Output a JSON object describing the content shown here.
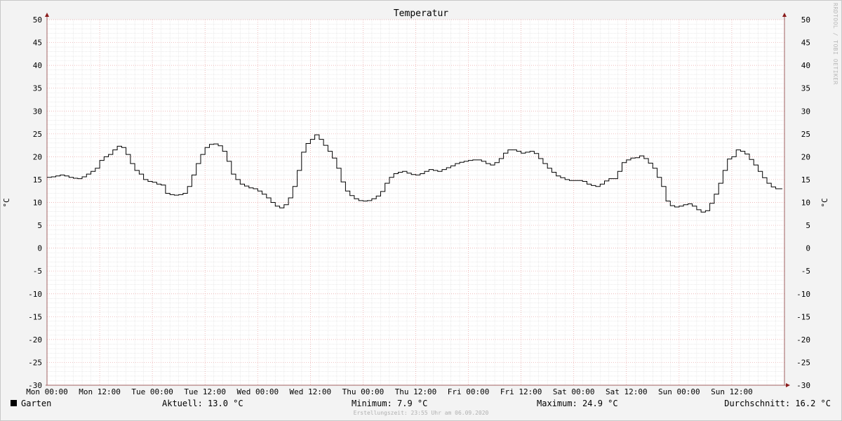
{
  "chart_data": {
    "type": "line",
    "title": "Temperatur",
    "ylabel": "°C",
    "ylim": [
      -30,
      50
    ],
    "yticks": [
      50,
      45,
      40,
      35,
      30,
      25,
      20,
      15,
      10,
      5,
      0,
      -5,
      -10,
      -15,
      -20,
      -25,
      -30
    ],
    "ytick_labels": [
      "50",
      "45",
      "40",
      "35",
      "30",
      "25",
      "20",
      "15",
      "10",
      "5",
      "0",
      "-5",
      "-10",
      "-15",
      "-20",
      "-25",
      "-30"
    ],
    "xlim_hours": [
      0,
      168
    ],
    "xtick_labels": [
      "Mon 00:00",
      "Mon 12:00",
      "Tue 00:00",
      "Tue 12:00",
      "Wed 00:00",
      "Wed 12:00",
      "Thu 00:00",
      "Thu 12:00",
      "Fri 00:00",
      "Fri 12:00",
      "Sat 00:00",
      "Sat 12:00",
      "Sun 00:00",
      "Sun 12:00"
    ],
    "grid": true,
    "line_color": "#000000",
    "grid_color": "#e8a0a0",
    "series": [
      {
        "name": "Garten",
        "color": "#000000",
        "x": [
          0,
          1,
          2,
          3,
          4,
          5,
          6,
          7,
          8,
          9,
          10,
          11,
          12,
          13,
          14,
          15,
          16,
          17,
          18,
          19,
          20,
          21,
          22,
          23,
          24,
          25,
          26,
          27,
          28,
          29,
          30,
          31,
          32,
          33,
          34,
          35,
          36,
          37,
          38,
          39,
          40,
          41,
          42,
          43,
          44,
          45,
          46,
          47,
          48,
          49,
          50,
          51,
          52,
          53,
          54,
          55,
          56,
          57,
          58,
          59,
          60,
          61,
          62,
          63,
          64,
          65,
          66,
          67,
          68,
          69,
          70,
          71,
          72,
          73,
          74,
          75,
          76,
          77,
          78,
          79,
          80,
          81,
          82,
          83,
          84,
          85,
          86,
          87,
          88,
          89,
          90,
          91,
          92,
          93,
          94,
          95,
          96,
          97,
          98,
          99,
          100,
          101,
          102,
          103,
          104,
          105,
          106,
          107,
          108,
          109,
          110,
          111,
          112,
          113,
          114,
          115,
          116,
          117,
          118,
          119,
          120,
          121,
          122,
          123,
          124,
          125,
          126,
          127,
          128,
          129,
          130,
          131,
          132,
          133,
          134,
          135,
          136,
          137,
          138,
          139,
          140,
          141,
          142,
          143,
          144,
          145,
          146,
          147,
          148,
          149,
          150,
          151,
          152,
          153,
          154,
          155,
          156,
          157,
          158,
          159,
          160,
          161,
          162,
          163,
          164,
          165,
          166,
          167
        ],
        "y": [
          15.5,
          15.6,
          15.8,
          16.0,
          15.8,
          15.5,
          15.3,
          15.2,
          15.6,
          16.2,
          16.8,
          17.5,
          19.2,
          20.0,
          20.5,
          21.5,
          22.3,
          22.0,
          20.5,
          18.5,
          17.0,
          16.2,
          15.0,
          14.6,
          14.4,
          14.0,
          13.8,
          12.0,
          11.7,
          11.6,
          11.7,
          12.0,
          13.5,
          16.0,
          18.5,
          20.5,
          22.0,
          22.7,
          22.8,
          22.4,
          21.2,
          19.0,
          16.2,
          15.0,
          14.0,
          13.6,
          13.2,
          13.0,
          12.5,
          11.8,
          11.0,
          10.0,
          9.2,
          8.8,
          9.5,
          11.0,
          13.5,
          17.0,
          21.0,
          22.9,
          23.8,
          24.8,
          23.8,
          22.5,
          21.2,
          19.7,
          17.5,
          14.5,
          12.5,
          11.5,
          10.8,
          10.4,
          10.3,
          10.4,
          10.8,
          11.4,
          12.4,
          14.2,
          15.5,
          16.3,
          16.6,
          16.8,
          16.4,
          16.1,
          16.0,
          16.3,
          16.8,
          17.2,
          17.0,
          16.8,
          17.2,
          17.6,
          18.0,
          18.5,
          18.8,
          19.0,
          19.2,
          19.3,
          19.3,
          19.0,
          18.5,
          18.2,
          18.7,
          19.6,
          20.8,
          21.5,
          21.5,
          21.2,
          20.8,
          21.0,
          21.2,
          20.7,
          19.6,
          18.5,
          17.5,
          16.6,
          15.8,
          15.4,
          15.0,
          14.8,
          14.8,
          14.8,
          14.6,
          14.0,
          13.7,
          13.5,
          14.0,
          14.7,
          15.2,
          15.2,
          16.8,
          18.7,
          19.3,
          19.7,
          19.8,
          20.2,
          19.6,
          18.6,
          17.5,
          15.5,
          13.5,
          10.3,
          9.3,
          9.0,
          9.2,
          9.5,
          9.7,
          9.2,
          8.4,
          7.9,
          8.2,
          9.8,
          11.8,
          14.2,
          17.0,
          19.5,
          20.0,
          21.5,
          21.2,
          20.6,
          19.4,
          18.2,
          16.8,
          15.4,
          14.2,
          13.4,
          13.0,
          13.0
        ]
      }
    ]
  },
  "legend": {
    "series_name": "Garten",
    "aktuell": "Aktuell: 13.0 °C",
    "minimum": "Minimum: 7.9 °C",
    "maximum": "Maximum: 24.9 °C",
    "durchschnitt": "Durchschnitt: 16.2 °C"
  },
  "footer": "Erstellungszeit: 23:55 Uhr am 06.09.2020",
  "watermark": "RRDTOOL / TOBI OETIKER"
}
